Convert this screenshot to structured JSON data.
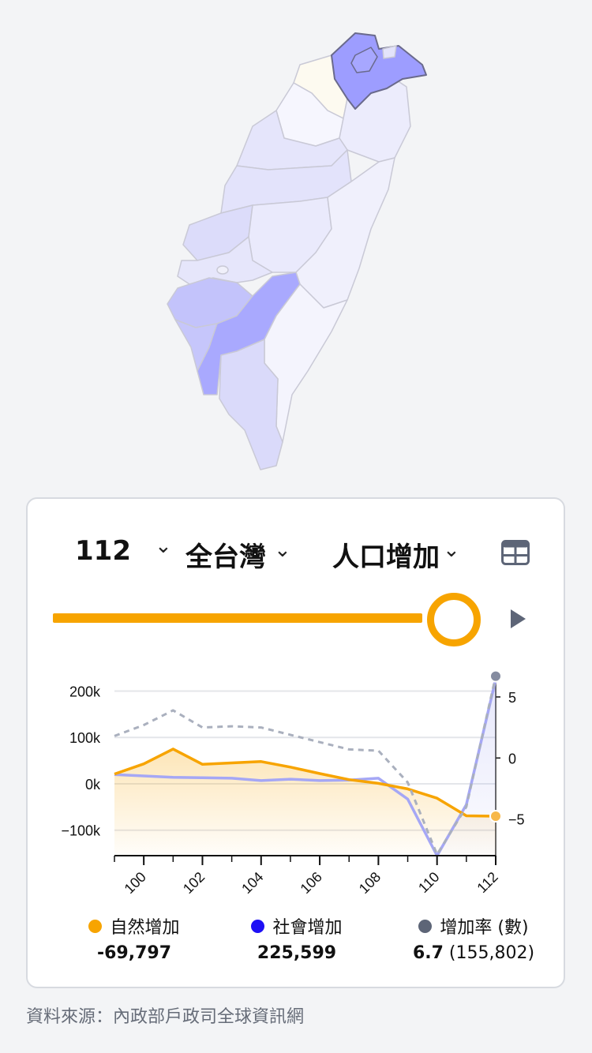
{
  "map": {
    "highlight_color": "#9999ff",
    "regions": [
      {
        "name": "north-east",
        "shade": "#9d9dff"
      },
      {
        "name": "taoyuan",
        "shade": "#fdfaf0"
      },
      {
        "name": "hsinchu",
        "shade": "#f6f6fe"
      },
      {
        "name": "yilan",
        "shade": "#ececfc"
      },
      {
        "name": "miaoli",
        "shade": "#e5e5fb"
      },
      {
        "name": "taichung",
        "shade": "#e3e3fb"
      },
      {
        "name": "nantou",
        "shade": "#eaeafc"
      },
      {
        "name": "changhua",
        "shade": "#dcdcfa"
      },
      {
        "name": "yunlin",
        "shade": "#e6e6fb"
      },
      {
        "name": "chiayi",
        "shade": "#c3c3fb"
      },
      {
        "name": "tainan",
        "shade": "#c6c6fb"
      },
      {
        "name": "kaohsiung",
        "shade": "#a9a9fe"
      },
      {
        "name": "hualien",
        "shade": "#f0f0fc"
      },
      {
        "name": "taitung",
        "shade": "#f4f4fd"
      },
      {
        "name": "pingtung",
        "shade": "#dadafa"
      }
    ]
  },
  "controls": {
    "year": "112",
    "region": "全台灣",
    "metric": "人口增加",
    "year_chevron": "⌄",
    "region_chevron": "⌄",
    "metric_chevron": "⌄"
  },
  "slider": {
    "progress": 1.0
  },
  "chart_data": {
    "type": "line",
    "x": [
      99,
      100,
      101,
      102,
      103,
      104,
      105,
      106,
      107,
      108,
      109,
      110,
      111,
      112
    ],
    "xticks": [
      "100",
      "102",
      "104",
      "106",
      "108",
      "110",
      "112"
    ],
    "xtick_values": [
      100,
      102,
      104,
      106,
      108,
      110,
      112
    ],
    "xlim": [
      99,
      112
    ],
    "yticks_left": [
      "200k",
      "100k",
      "0k",
      "−100k"
    ],
    "ytick_left_values": [
      200000,
      100000,
      0,
      -100000
    ],
    "ylim_left": [
      -155000,
      240000
    ],
    "yticks_right": [
      "5",
      "0",
      "−5"
    ],
    "ytick_right_values": [
      5,
      0,
      -5
    ],
    "ylim_right": [
      -8,
      7
    ],
    "grid": true,
    "series": [
      {
        "name": "自然增加",
        "axis": "left",
        "color": "#f7a400",
        "style": "solid-area",
        "values": [
          21000,
          43000,
          75000,
          42000,
          45000,
          48000,
          36000,
          22000,
          9000,
          1000,
          -11000,
          -31000,
          -69000,
          -69797
        ]
      },
      {
        "name": "社會增加",
        "axis": "left",
        "color": "#1e10f5",
        "style": "solid",
        "values": [
          20000,
          17000,
          14000,
          13000,
          12000,
          7000,
          10000,
          7000,
          8000,
          12000,
          -33000,
          -155000,
          -45000,
          225599
        ]
      },
      {
        "name": "增加率 (數)",
        "axis": "right",
        "color": "#5d6577",
        "style": "dashed",
        "values": [
          1.8,
          2.7,
          3.9,
          2.5,
          2.6,
          2.5,
          1.9,
          1.3,
          0.7,
          0.6,
          -2.0,
          -7.9,
          -4.0,
          6.7
        ]
      }
    ]
  },
  "legend": [
    {
      "label": "自然增加",
      "color": "#f7a400",
      "value": "-69,797",
      "extra": ""
    },
    {
      "label": "社會增加",
      "color": "#1e10f5",
      "value": "225,599",
      "extra": ""
    },
    {
      "label": "增加率 (數)",
      "color": "#5d6577",
      "value": "6.7",
      "extra": " (155,802)"
    }
  ],
  "source": "資料來源：內政部戶政司全球資訊網"
}
